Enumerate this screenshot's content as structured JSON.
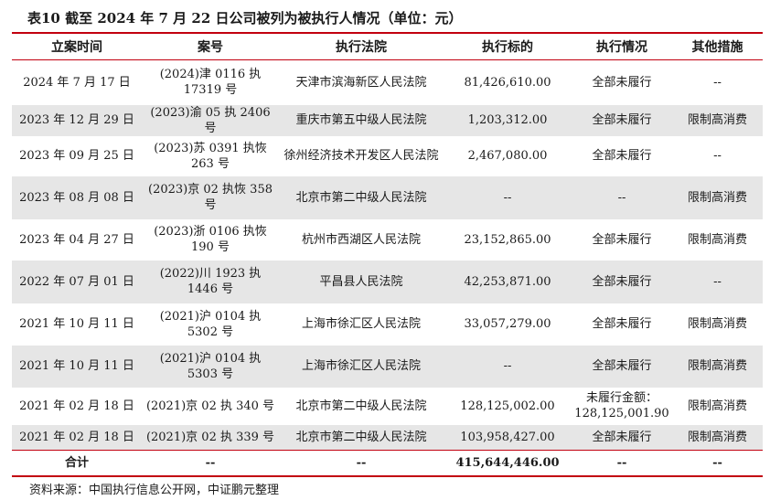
{
  "title": "表10 截至 2024 年 7 月 22 日公司被列为被执行人情况（单位：元）",
  "headers": [
    "立案时间",
    "案号",
    "执行法院",
    "执行标的",
    "执行情况",
    "其他措施"
  ],
  "rows": [
    {
      "date": "2024 年 7 月 17 日",
      "case_no": "(2024)津 0116 执 17319 号",
      "court": "天津市滨海新区人民法院",
      "amount": "81,426,610.00",
      "status": "全部未履行",
      "other": "--"
    },
    {
      "date": "2023 年 12 月 29 日",
      "case_no": "(2023)渝 05 执 2406 号",
      "court": "重庆市第五中级人民法院",
      "amount": "1,203,312.00",
      "status": "全部未履行",
      "other": "限制高消费"
    },
    {
      "date": "2023 年 09 月 25 日",
      "case_no": "(2023)苏 0391 执恢 263 号",
      "court": "徐州经济技术开发区人民法院",
      "amount": "2,467,080.00",
      "status": "全部未履行",
      "other": "--"
    },
    {
      "date": "2023 年 08 月 08 日",
      "case_no": "(2023)京 02 执恢 358 号",
      "court": "北京市第二中级人民法院",
      "amount": "--",
      "status": "--",
      "other": "限制高消费"
    },
    {
      "date": "2023 年 04 月 27 日",
      "case_no": "(2023)浙 0106 执恢 190 号",
      "court": "杭州市西湖区人民法院",
      "amount": "23,152,865.00",
      "status": "全部未履行",
      "other": "限制高消费"
    },
    {
      "date": "2022 年 07 月 01 日",
      "case_no": "(2022)川 1923 执 1446 号",
      "court": "平昌县人民法院",
      "amount": "42,253,871.00",
      "status": "全部未履行",
      "other": "--"
    },
    {
      "date": "2021 年 10 月 11 日",
      "case_no": "(2021)沪 0104 执 5302 号",
      "court": "上海市徐汇区人民法院",
      "amount": "33,057,279.00",
      "status": "全部未履行",
      "other": "限制高消费"
    },
    {
      "date": "2021 年 10 月 11 日",
      "case_no": "(2021)沪 0104 执 5303 号",
      "court": "上海市徐汇区人民法院",
      "amount": "--",
      "status": "全部未履行",
      "other": "限制高消费"
    },
    {
      "date": "2021 年 02 月 18 日",
      "case_no": "(2021)京 02 执 340 号",
      "court": "北京市第二中级人民法院",
      "amount": "128,125,002.00",
      "status": "未履行金额：128,125,001.90",
      "other": "限制高消费"
    },
    {
      "date": "2021 年 02 月 18 日",
      "case_no": "(2021)京 02 执 339 号",
      "court": "北京市第二中级人民法院",
      "amount": "103,958,427.00",
      "status": "全部未履行",
      "other": "限制高消费"
    }
  ],
  "total": {
    "label": "合计",
    "case_no": "--",
    "court": "--",
    "amount": "415,644,446.00",
    "status": "--",
    "other": "--"
  },
  "source": "资料来源：中国执行信息公开网，中证鹏元整理",
  "colors": {
    "rule": "#c2000f",
    "stripe": "#e6e6e6"
  }
}
